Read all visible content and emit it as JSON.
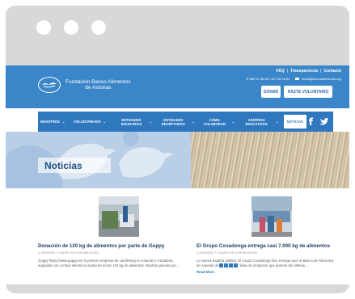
{
  "header": {
    "top_links": [
      "FAQ",
      "Transparencia",
      "Contacto"
    ],
    "top_links_separator": "|",
    "phone": "985 11 58 66 / 627 56 18 61",
    "email": "marta@bancoalimentos.org",
    "logo_text_line1": "Fundación Banco Alimentos",
    "logo_text_line2": "de Asturias",
    "donate_label": "DONAR",
    "volunteer_label": "HAZTE VOLUNTARIO"
  },
  "nav": {
    "items": [
      {
        "label": "NOSOTROS"
      },
      {
        "label": "VOLUNTARIADO"
      },
      {
        "label": "ENTIDADES SOLIDARIAS"
      },
      {
        "label": "ENTIDADES RECEPTORAS"
      },
      {
        "label": "CÓMO COLABORAR"
      },
      {
        "label": "CENTROS EDUCATIVOS"
      },
      {
        "label": "NOTICIAS"
      }
    ],
    "caret": "⌄",
    "facebook_label": "f"
  },
  "banner": {
    "title": "Noticias"
  },
  "posts": [
    {
      "title": "Donación de 120 kg de alimentos por parte de Guppy",
      "date": "30/03/2021",
      "author": "EQUIPO DE COMUNICACIÓN",
      "excerpt": "Guppy https://www.guppy.es/ la primera empresa de carsharing en Asturias y Cantabria, equipada con coches eléctricos acaba de donar 120 kg de alimentos. Muchas gracias por…"
    },
    {
      "title": "El Grupo Covadonga entrega casi 7.000 kg de alimentos",
      "date": "26/03/2021",
      "author": "EQUIPO DE COMUNICACIÓN",
      "excerpt_start": "La Nueva España publica: El Grupo Covadonga hizo entrega ayer al Banco de Alimentos de Asturias de",
      "excerpt_end": "kilos de productos que durante las últimas…",
      "read_more": "Read More"
    }
  ]
}
